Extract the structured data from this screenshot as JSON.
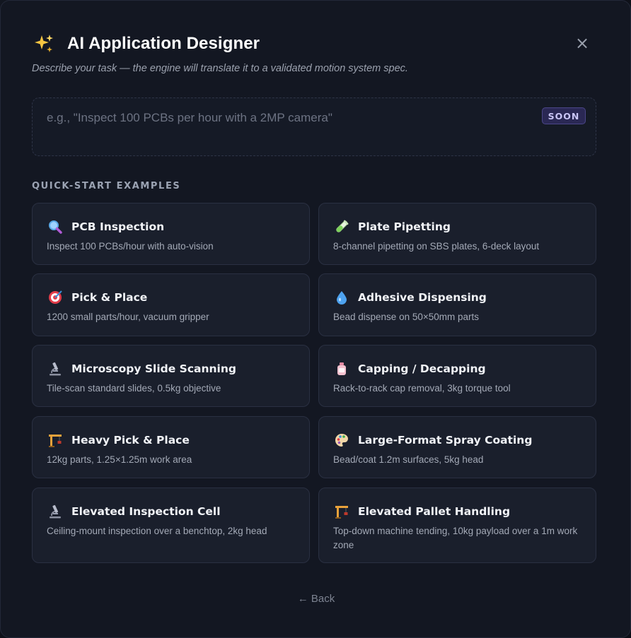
{
  "dialog": {
    "title": "AI Application Designer",
    "title_icon": "sparkles-icon",
    "subtitle": "Describe your task — the engine will translate it to a validated motion system spec.",
    "close_label": "×"
  },
  "prompt": {
    "value": "",
    "placeholder": "e.g., \"Inspect 100 PCBs per hour with a 2MP camera\"",
    "badge": "SOON"
  },
  "section_label": "QUICK-START EXAMPLES",
  "examples": [
    {
      "title": "PCB Inspection",
      "desc": "Inspect 100 PCBs/hour with auto-vision",
      "icon": "magnifier-icon"
    },
    {
      "title": "Plate Pipetting",
      "desc": "8-channel pipetting on SBS plates, 6-deck layout",
      "icon": "test-tube-icon"
    },
    {
      "title": "Pick & Place",
      "desc": "1200 small parts/hour, vacuum gripper",
      "icon": "target-icon"
    },
    {
      "title": "Adhesive Dispensing",
      "desc": "Bead dispense on 50×50mm parts",
      "icon": "droplet-icon"
    },
    {
      "title": "Microscopy Slide Scanning",
      "desc": "Tile-scan standard slides, 0.5kg objective",
      "icon": "microscope-icon"
    },
    {
      "title": "Capping / Decapping",
      "desc": "Rack-to-rack cap removal, 3kg torque tool",
      "icon": "bottle-icon"
    },
    {
      "title": "Heavy Pick & Place",
      "desc": "12kg parts, 1.25×1.25m work area",
      "icon": "crane-icon"
    },
    {
      "title": "Large-Format Spray Coating",
      "desc": "Bead/coat 1.2m surfaces, 5kg head",
      "icon": "palette-icon"
    },
    {
      "title": "Elevated Inspection Cell",
      "desc": "Ceiling-mount inspection over a benchtop, 2kg head",
      "icon": "microscope-icon"
    },
    {
      "title": "Elevated Pallet Handling",
      "desc": "Top-down machine tending, 10kg payload over a 1m work zone",
      "icon": "crane-icon"
    }
  ],
  "footer": {
    "back_label": "← Back"
  }
}
